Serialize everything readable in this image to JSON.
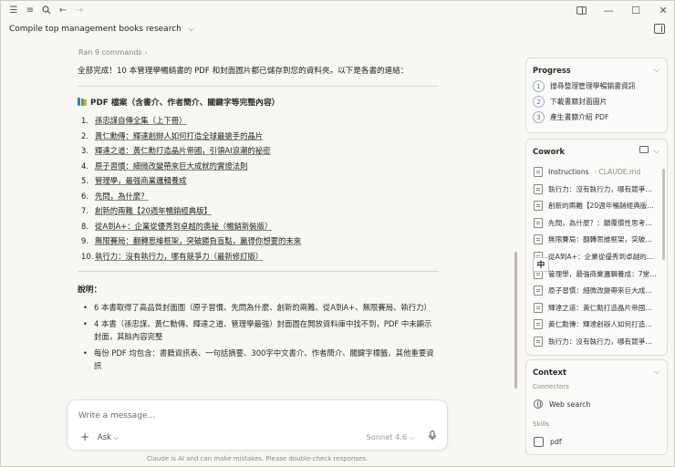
{
  "header": {
    "project_title": "Compile top management books research"
  },
  "chat": {
    "ran_label": "Ran 9 commands",
    "intro": "全部完成！10 本管理學暢銷書的 PDF 和封面圖片都已儲存到您的資料夾。以下是各書的連結：",
    "pdf_section_title": "PDF 檔案（含書介、作者簡介、關鍵字等完整內容）",
    "books": [
      {
        "num": "1.",
        "title": "孫忠謀自傳全集（上下冊）"
      },
      {
        "num": "2.",
        "title": "黃仁勳傳：輝達創辦人如何打造全球最搶手的晶片"
      },
      {
        "num": "3.",
        "title": "輝達之道：黃仁勳打造晶片帝國，引領AI浪潮的祕密"
      },
      {
        "num": "4.",
        "title": "原子習慣：細微改變帶來巨大成就的實證法則"
      },
      {
        "num": "5.",
        "title": "管理學，最強商業邏輯養成"
      },
      {
        "num": "6.",
        "title": "先問，為什麼？"
      },
      {
        "num": "7.",
        "title": "創新的兩難【20週年暢銷經典版】"
      },
      {
        "num": "8.",
        "title": "從A到A+：企業從優秀到卓越的奧祕（暢銷新裝版）"
      },
      {
        "num": "9.",
        "title": "無限賽局：翻轉思維框架，突破勝負盲點，贏得你想要的未來"
      },
      {
        "num": "10.",
        "title": "執行力：沒有執行力，哪有競爭力（最新修訂版）"
      }
    ],
    "notes_title": "說明：",
    "notes": [
      "6 本書取得了高品質封面圖（原子習慣、先問為什麼、創新的兩難、從A到A+、無限賽局、執行力）",
      "4 本書（孫忠謀、黃仁勳傳、輝達之道、管理學最強）封面圖在開放資料庫中找不到，PDF 中未顯示封面，其餘內容完整",
      "每份 PDF 均包含：書籍資訊表、一句話摘要、300字中文書介、作者簡介、關鍵字標籤、其他重要資訊"
    ]
  },
  "composer": {
    "placeholder": "Write a message…",
    "ask_label": "Ask",
    "model_label": "Sonnet 4.6",
    "footer": "Claude is AI and can make mistakes. Please double-check responses."
  },
  "progress": {
    "title": "Progress",
    "steps": [
      {
        "num": "1",
        "label": "搜尋整理管理學暢銷書資訊"
      },
      {
        "num": "2",
        "label": "下載書籍封面圖片"
      },
      {
        "num": "3",
        "label": "產生書籍介紹 PDF"
      }
    ]
  },
  "cowork": {
    "title": "Cowork",
    "files": [
      {
        "name": "Instructions",
        "suffix": " · CLAUDE.md"
      },
      {
        "name": "執行力：沒有執行力，哪有競爭…",
        "suffix": ""
      },
      {
        "name": "創新的兩難【20週年暢銷經典版…",
        "suffix": ""
      },
      {
        "name": "先問，為什麼？：顛覆慣性思考…",
        "suffix": ""
      },
      {
        "name": "無限賽局：翻轉思維框架，突破…",
        "suffix": ""
      },
      {
        "name": "從A到A+：企業從優秀到卓越的…",
        "suffix": ""
      },
      {
        "name": "管理學，最強商業邏輯養成：7堂…",
        "suffix": ""
      },
      {
        "name": "原子習慣：細微改變帶來巨大成…",
        "suffix": ""
      },
      {
        "name": "輝達之道：黃仁勳打造晶片帝國…",
        "suffix": ""
      },
      {
        "name": "黃仁勳傳：輝達創辦人如何打造…",
        "suffix": ""
      },
      {
        "name": "執行力：沒有執行力，哪有競爭…",
        "suffix": ""
      }
    ],
    "tooltip": "中"
  },
  "context": {
    "title": "Context",
    "connectors_label": "Connectors",
    "connector": "Web search",
    "skills_label": "Skills",
    "skill": "pdf"
  }
}
